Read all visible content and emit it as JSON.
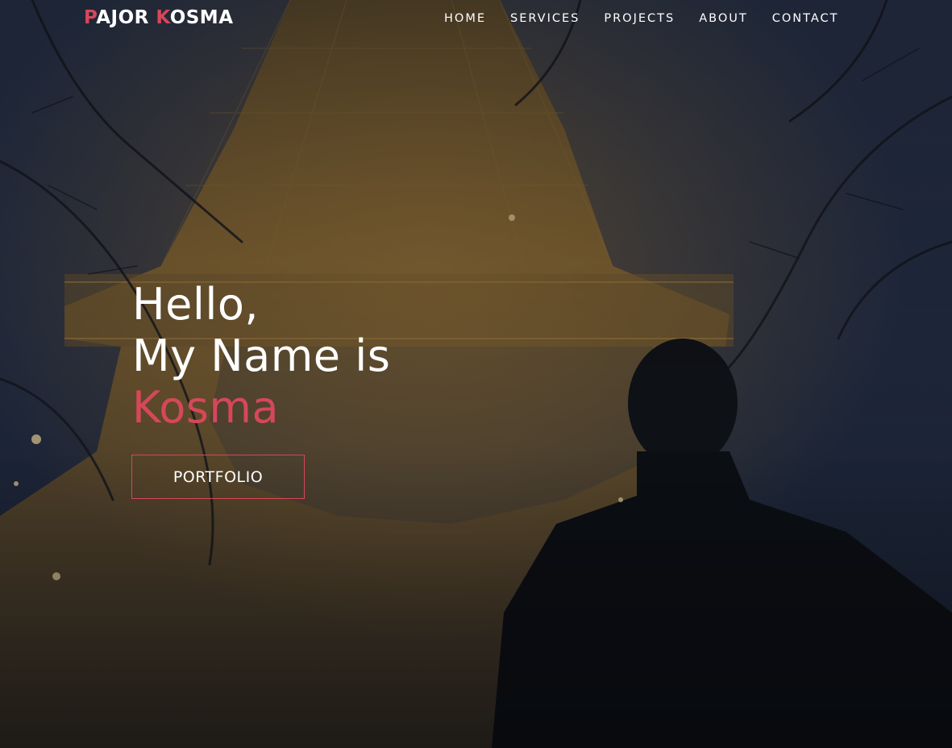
{
  "brand": {
    "logo_first_initial": "P",
    "logo_first_rest": "AJOR",
    "logo_second_initial": "K",
    "logo_second_rest": "OSMA"
  },
  "nav": {
    "items": [
      {
        "label": "HOME"
      },
      {
        "label": "SERVICES"
      },
      {
        "label": "PROJECTS"
      },
      {
        "label": "ABOUT"
      },
      {
        "label": "CONTACT"
      }
    ]
  },
  "hero": {
    "line1": "Hello,",
    "line2": "My Name is",
    "name": "Kosma",
    "button_label": "PORTFOLIO",
    "background": "photo-eiffel-tower-at-dusk"
  },
  "colors": {
    "accent": "#d6475a",
    "text": "#ffffff"
  }
}
